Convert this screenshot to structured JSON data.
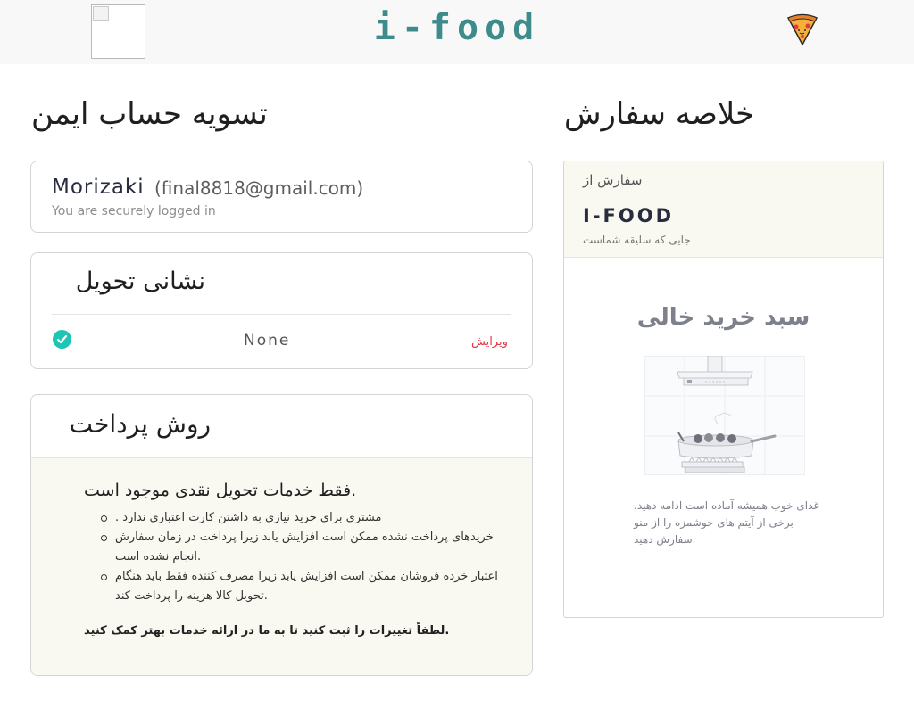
{
  "header": {
    "logo": "i-food",
    "pizza_icon": "pizza-icon",
    "broken_image_icon": "broken-image-icon"
  },
  "checkout": {
    "title": "تسویه حساب ایمن",
    "user": {
      "name": "Morizaki",
      "email": "(final8818@gmail.com)",
      "status": "You are securely logged in"
    },
    "address": {
      "title": "نشانی تحویل",
      "value": "None",
      "edit_label": "ویرایش",
      "check_icon": "check-icon"
    },
    "payment": {
      "title": "روش پرداخت",
      "heading": "فقط خدمات تحویل نقدی موجود است.",
      "points": [
        ". مشتری برای خرید نیازی به داشتن کارت اعتباری ندارد",
        "خریدهای پرداخت نشده ممکن است افزایش یابد زیرا پرداخت در زمان سفارش انجام نشده است.",
        "اعتبار خرده فروشان ممکن است افزایش یابد زیرا مصرف کننده فقط باید هنگام تحویل کالا هزینه را پرداخت کند."
      ],
      "footer": "لطفاً تغییرات را ثبت کنید تا به ما در ارائه خدمات بهتر کمک کنید."
    }
  },
  "summary": {
    "title": "خلاصه سفارش",
    "from_label": "سفارش از",
    "restaurant": "I-FOOD",
    "tagline": "جایی که سلیقه شماست",
    "empty_title": "سبد خرید خالی",
    "empty_text": "غذای خوب همیشه آماده است ادامه دهید، برخی از آیتم های خوشمزه را از منو سفارش دهید.",
    "illustration_icon": "empty-kitchen-illustration"
  }
}
